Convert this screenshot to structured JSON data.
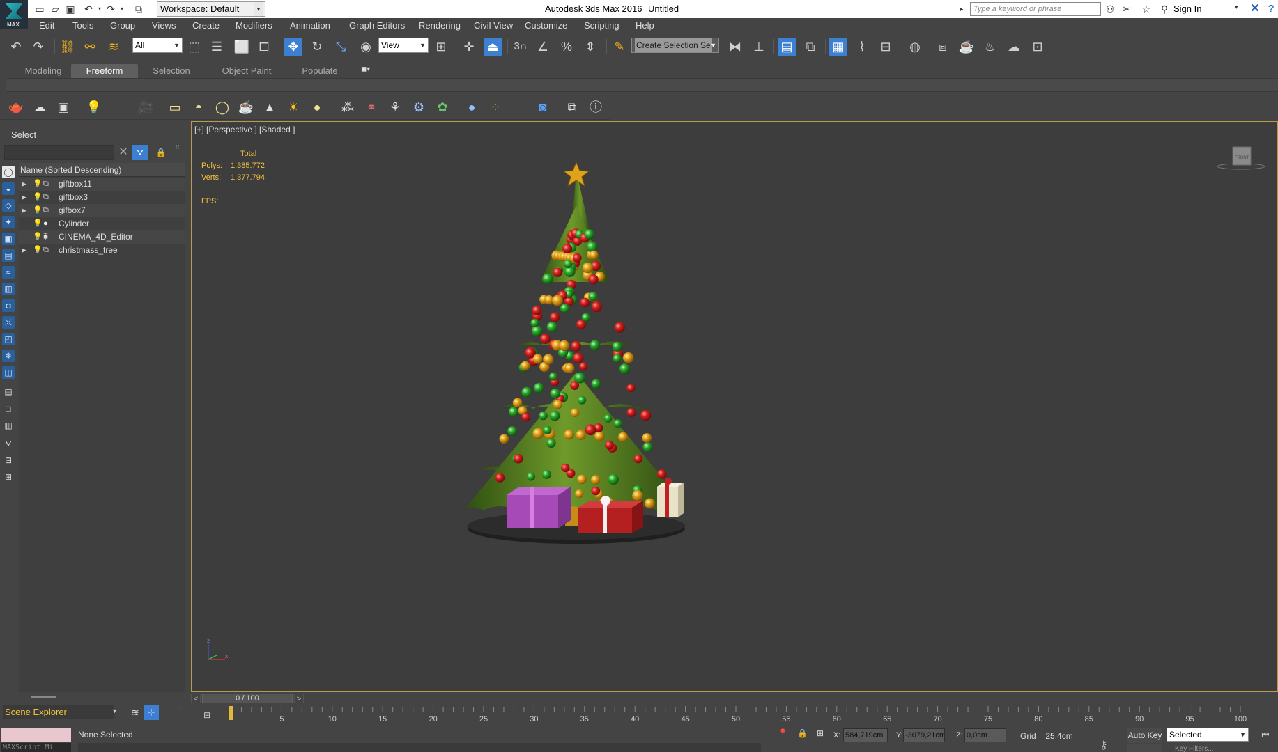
{
  "titlebar": {
    "app_title": "Autodesk 3ds Max 2016",
    "doc_title": "Untitled",
    "workspace": "Workspace: Default",
    "search_placeholder": "Type a keyword or phrase",
    "sign_in": "Sign In",
    "logo_text": "MAX"
  },
  "menu": [
    "Edit",
    "Tools",
    "Group",
    "Views",
    "Create",
    "Modifiers",
    "Animation",
    "Graph Editors",
    "Rendering",
    "Civil View",
    "Customize",
    "Scripting",
    "Help"
  ],
  "toolbar": {
    "filter_dropdown": "All",
    "refcoord_dropdown": "View",
    "selection_set": "Create Selection Se",
    "snap_label": "3"
  },
  "ribbon": {
    "tabs": [
      "Modeling",
      "Freeform",
      "Selection",
      "Object Paint",
      "Populate"
    ],
    "active_tab": "Freeform"
  },
  "explorer": {
    "title": "Select",
    "column_header": "Name (Sorted Descending)",
    "items": [
      {
        "name": "giftbox11",
        "expandable": true,
        "type": "group"
      },
      {
        "name": "giftbox3",
        "expandable": true,
        "type": "group"
      },
      {
        "name": "gifbox7",
        "expandable": true,
        "type": "group"
      },
      {
        "name": "Cylinder",
        "expandable": false,
        "type": "geometry"
      },
      {
        "name": "CINEMA_4D_Editor",
        "expandable": false,
        "type": "camera"
      },
      {
        "name": "christmass_tree",
        "expandable": true,
        "type": "group"
      }
    ],
    "footer_label": "Scene Explorer"
  },
  "viewport": {
    "label": "[+] [Perspective ] [Shaded ]",
    "stats_title": "Total",
    "polys_label": "Polys:",
    "polys_value": "1.385.772",
    "verts_label": "Verts:",
    "verts_value": "1.377.794",
    "fps_label": "FPS:",
    "viewcube_label": "FRONT",
    "axis_z": "z",
    "axis_x": "x"
  },
  "timeslider": {
    "current": "0 / 100",
    "prev": "<",
    "next": ">"
  },
  "trackbar": {
    "ticks": [
      5,
      10,
      15,
      20,
      25,
      30,
      35,
      40,
      45,
      50,
      55,
      60,
      65,
      70,
      75,
      80,
      85,
      90,
      95,
      100
    ],
    "start": 0,
    "end": 100,
    "current_frame": 0
  },
  "status": {
    "message": "None Selected",
    "maxscript_text": "MAXScript Mi",
    "x_label": "X:",
    "x_value": "584,719cm",
    "y_label": "Y:",
    "y_value": "-3079,21cm",
    "z_label": "Z:",
    "z_value": "0,0cm",
    "grid": "Grid = 25,4cm",
    "autokey": "Auto Key",
    "selected_dropdown": "Selected",
    "key_filters": "Key Filters..."
  },
  "colors": {
    "accent": "#3d7fd0",
    "highlight": "#f2b318",
    "stats": "#f0c040"
  }
}
